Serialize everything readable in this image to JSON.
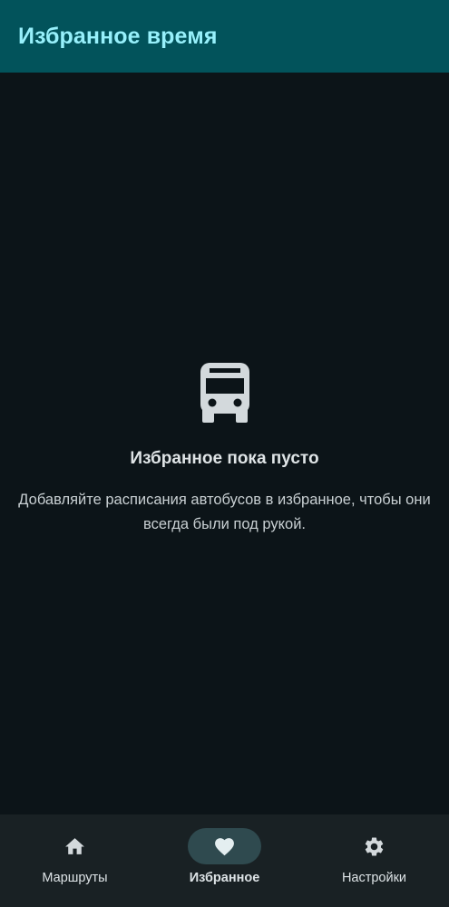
{
  "app_bar": {
    "title": "Избранное время"
  },
  "empty_state": {
    "icon": "bus-icon",
    "title": "Избранное пока пусто",
    "subtitle": "Добавляйте расписания автобусов в избранное, чтобы они всегда были под рукой."
  },
  "bottom_nav": {
    "items": [
      {
        "label": "Маршруты",
        "icon": "home-icon",
        "selected": false
      },
      {
        "label": "Избранное",
        "icon": "heart-icon",
        "selected": true
      },
      {
        "label": "Настройки",
        "icon": "gear-icon",
        "selected": false
      }
    ]
  },
  "colors": {
    "app_bar_bg": "#02535b",
    "app_bar_title": "#97f0fb",
    "background": "#0c1418",
    "nav_bg": "#192124",
    "nav_selected_pill": "#2f4a4f",
    "icon_color": "#d3d9dc"
  }
}
